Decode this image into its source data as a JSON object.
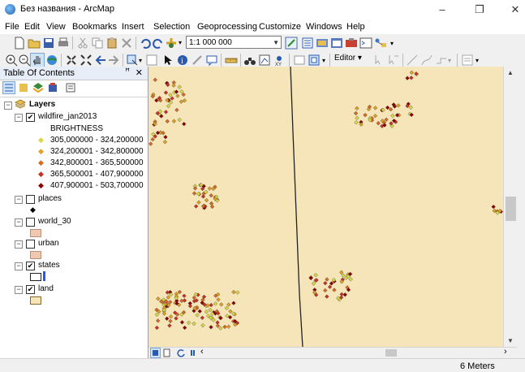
{
  "window": {
    "title": "Без названия - ArcMap",
    "minimize": "–",
    "maximize": "❐",
    "close": "✕"
  },
  "menu": [
    "File",
    "Edit",
    "View",
    "Bookmarks",
    "Insert",
    "Selection",
    "Geoprocessing",
    "Customize",
    "Windows",
    "Help"
  ],
  "toolbar": {
    "scale": "1:1 000 000",
    "editor_label": "Editor ▾"
  },
  "toc": {
    "title": "Table Of Contents",
    "pin": "ꟸ",
    "close": "✕",
    "root": "Layers",
    "layers": [
      {
        "name": "wildfire_jan2013",
        "checked": true,
        "field": "BRIGHTNESS",
        "classes": [
          {
            "label": "305,000000 - 324,200000",
            "color": "#d8d840"
          },
          {
            "label": "324,200001 - 342,800000",
            "color": "#e0a020"
          },
          {
            "label": "342,800001 - 365,500000",
            "color": "#d86a20"
          },
          {
            "label": "365,500001 - 407,900000",
            "color": "#c83020"
          },
          {
            "label": "407,900001 - 503,700000",
            "color": "#8b0000"
          }
        ]
      },
      {
        "name": "places",
        "checked": false
      },
      {
        "name": "world_30",
        "checked": false
      },
      {
        "name": "urban",
        "checked": false
      },
      {
        "name": "states",
        "checked": true
      },
      {
        "name": "land",
        "checked": true
      }
    ]
  },
  "colors": {
    "map_background": "#f5e5b8",
    "state_border": "#222222",
    "land_fill": "#f5e5b8",
    "urban_fill": "#f0c8b0"
  },
  "status": {
    "units": "6 Meters"
  }
}
